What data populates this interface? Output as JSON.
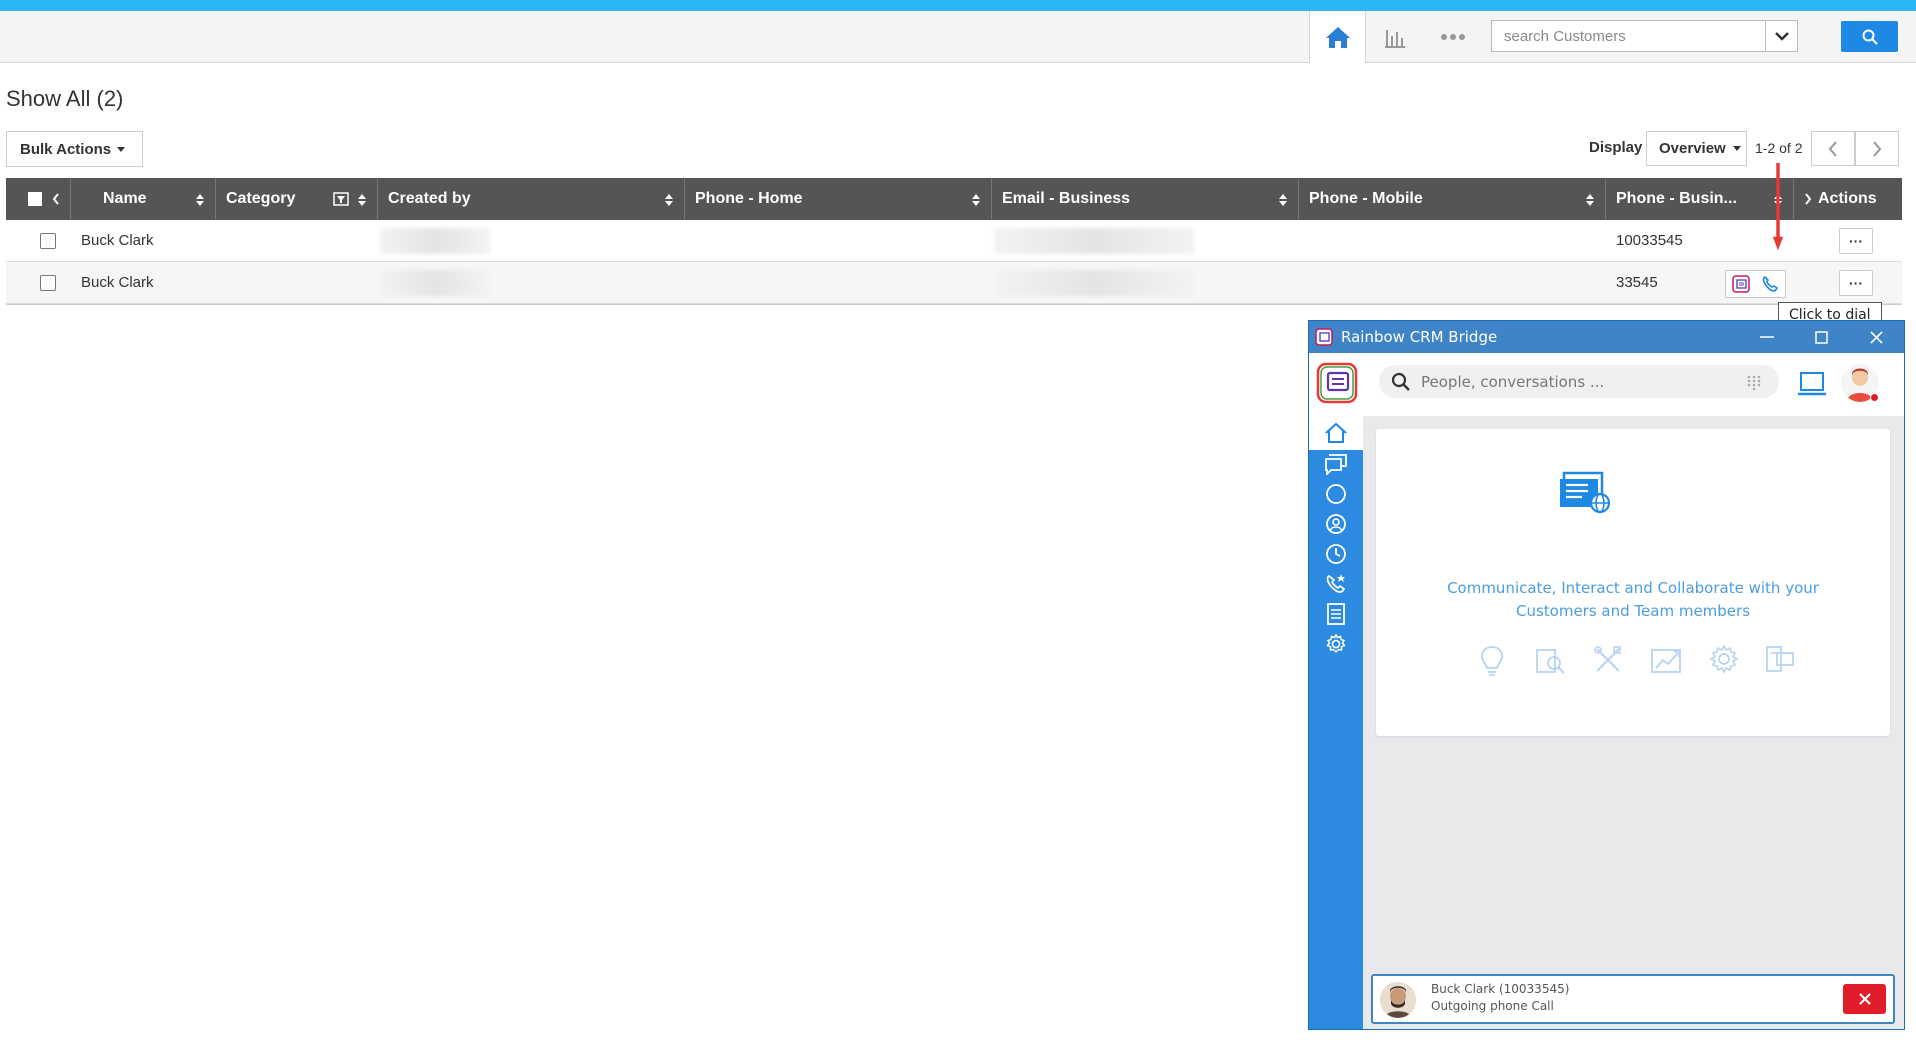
{
  "header": {
    "search_placeholder": "search Customers",
    "icons": [
      "home-icon",
      "chart-icon",
      "more-icon",
      "chevron-down-icon",
      "search-icon"
    ]
  },
  "page": {
    "title": "Show All (2)",
    "bulk_actions_label": "Bulk Actions",
    "display_label": "Display",
    "display_value": "Overview",
    "pager_text": "1-2 of 2"
  },
  "grid": {
    "columns": [
      "Name",
      "Category",
      "Created by",
      "Phone - Home",
      "Email - Business",
      "Phone - Mobile",
      "Phone - Busin...",
      "Actions"
    ],
    "rows": [
      {
        "name": "Buck Clark",
        "category": "",
        "created_by": "",
        "phone_home": "",
        "email_business": "",
        "phone_mobile": "",
        "phone_business": "10033545",
        "actions": "···"
      },
      {
        "name": "Buck Clark",
        "category": "",
        "created_by": "",
        "phone_home": "",
        "email_business": "",
        "phone_mobile": "",
        "phone_business": "33545",
        "actions": "···"
      }
    ]
  },
  "tooltip": {
    "text": "Click to dial"
  },
  "rainbow": {
    "window_title": "Rainbow CRM Bridge",
    "search_placeholder": "People, conversations ...",
    "welcome_line1": "Communicate, Interact and Collaborate with your",
    "welcome_line2": "Customers and Team members",
    "call": {
      "contact": "Buck Clark (10033545)",
      "status": "Outgoing phone Call"
    },
    "accent_color": "#2c8be0",
    "hangup_color": "#e21d2a"
  },
  "colors": {
    "top_strip": "#29b6f6",
    "grid_header": "#555555",
    "primary_button": "#1e88e5"
  }
}
